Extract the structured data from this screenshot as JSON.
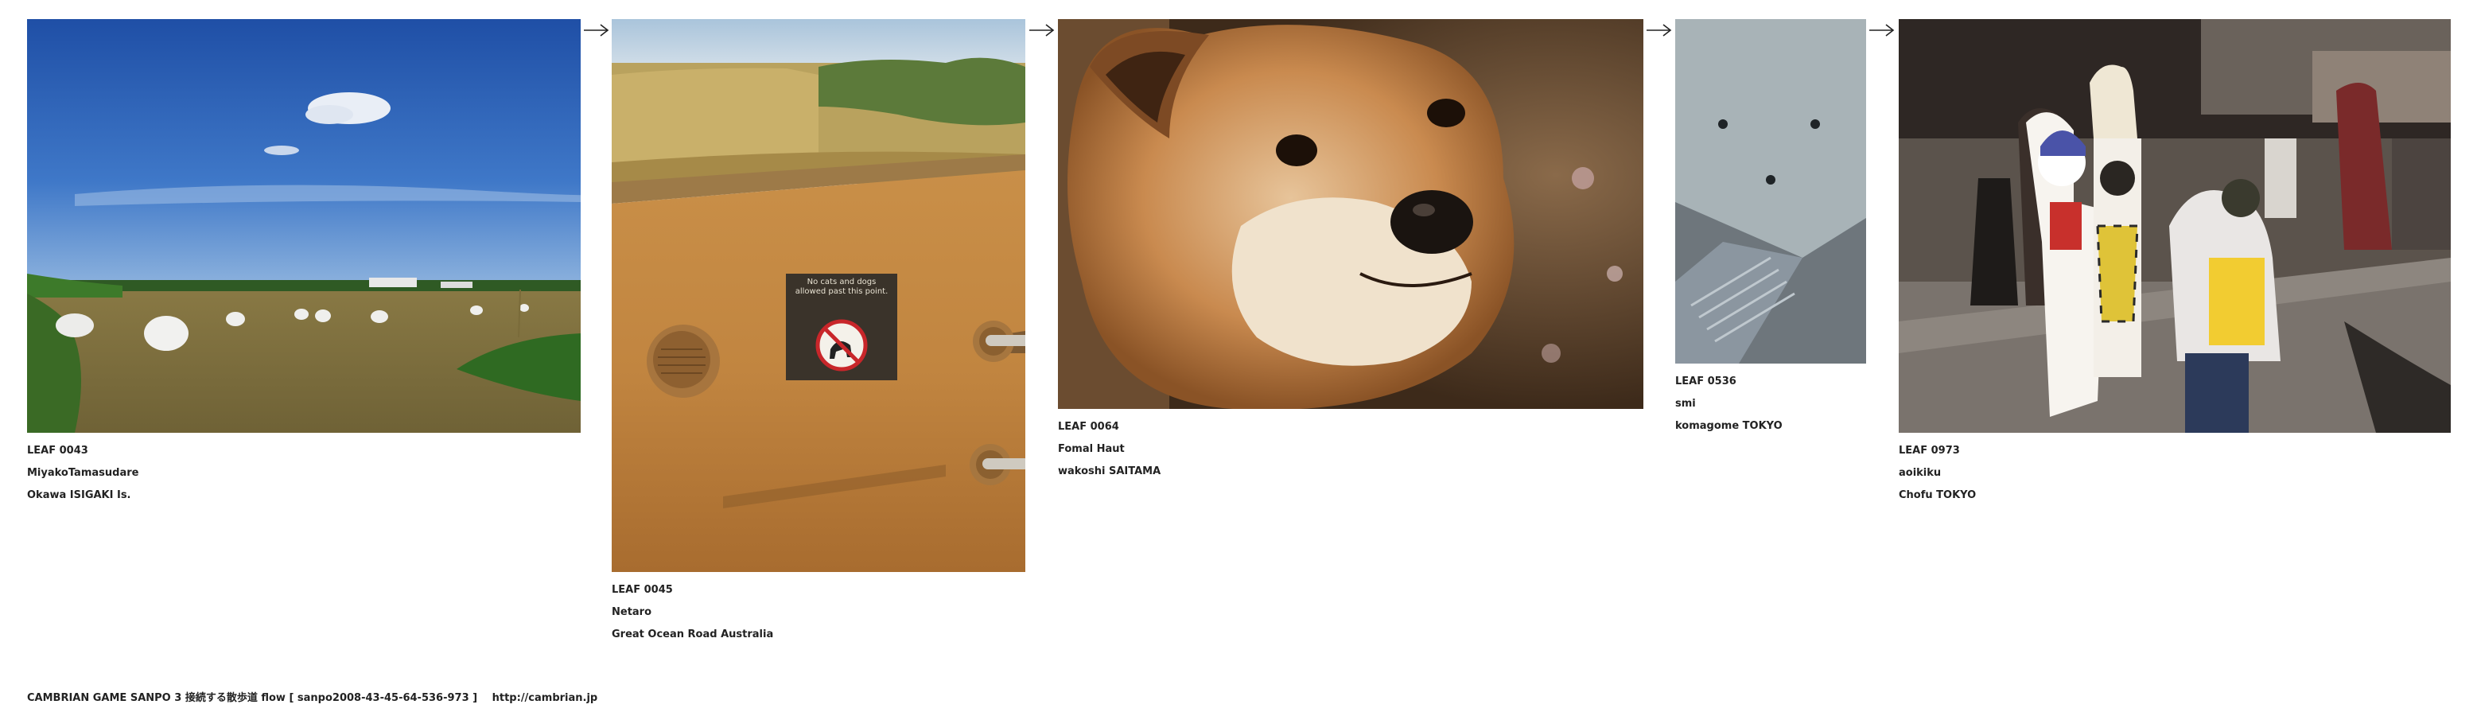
{
  "leaves": [
    {
      "id": "LEAF 0043",
      "author": "MiyakoTamasudare",
      "place": "Okawa ISIGAKI Is."
    },
    {
      "id": "LEAF 0045",
      "author": "Netaro",
      "place": "Great Ocean Road Australia",
      "sign_line1": "No cats and dogs",
      "sign_line2": "allowed past this point."
    },
    {
      "id": "LEAF 0064",
      "author": "Fomal Haut",
      "place": "wakoshi SAITAMA"
    },
    {
      "id": "LEAF 0536",
      "author": "smi",
      "place": "komagome TOKYO"
    },
    {
      "id": "LEAF 0973",
      "author": "aoikiku",
      "place": "Chofu  TOKYO"
    }
  ],
  "footer": {
    "text": "CAMBRIAN GAME  SANPO 3 接続する散歩道 flow [ sanpo2008-43-45-64-536-973 ]",
    "link": "http://cambrian.jp"
  },
  "colors": {
    "text": "#222222",
    "background": "#ffffff"
  },
  "icons": [
    "arrow-right-icon"
  ]
}
